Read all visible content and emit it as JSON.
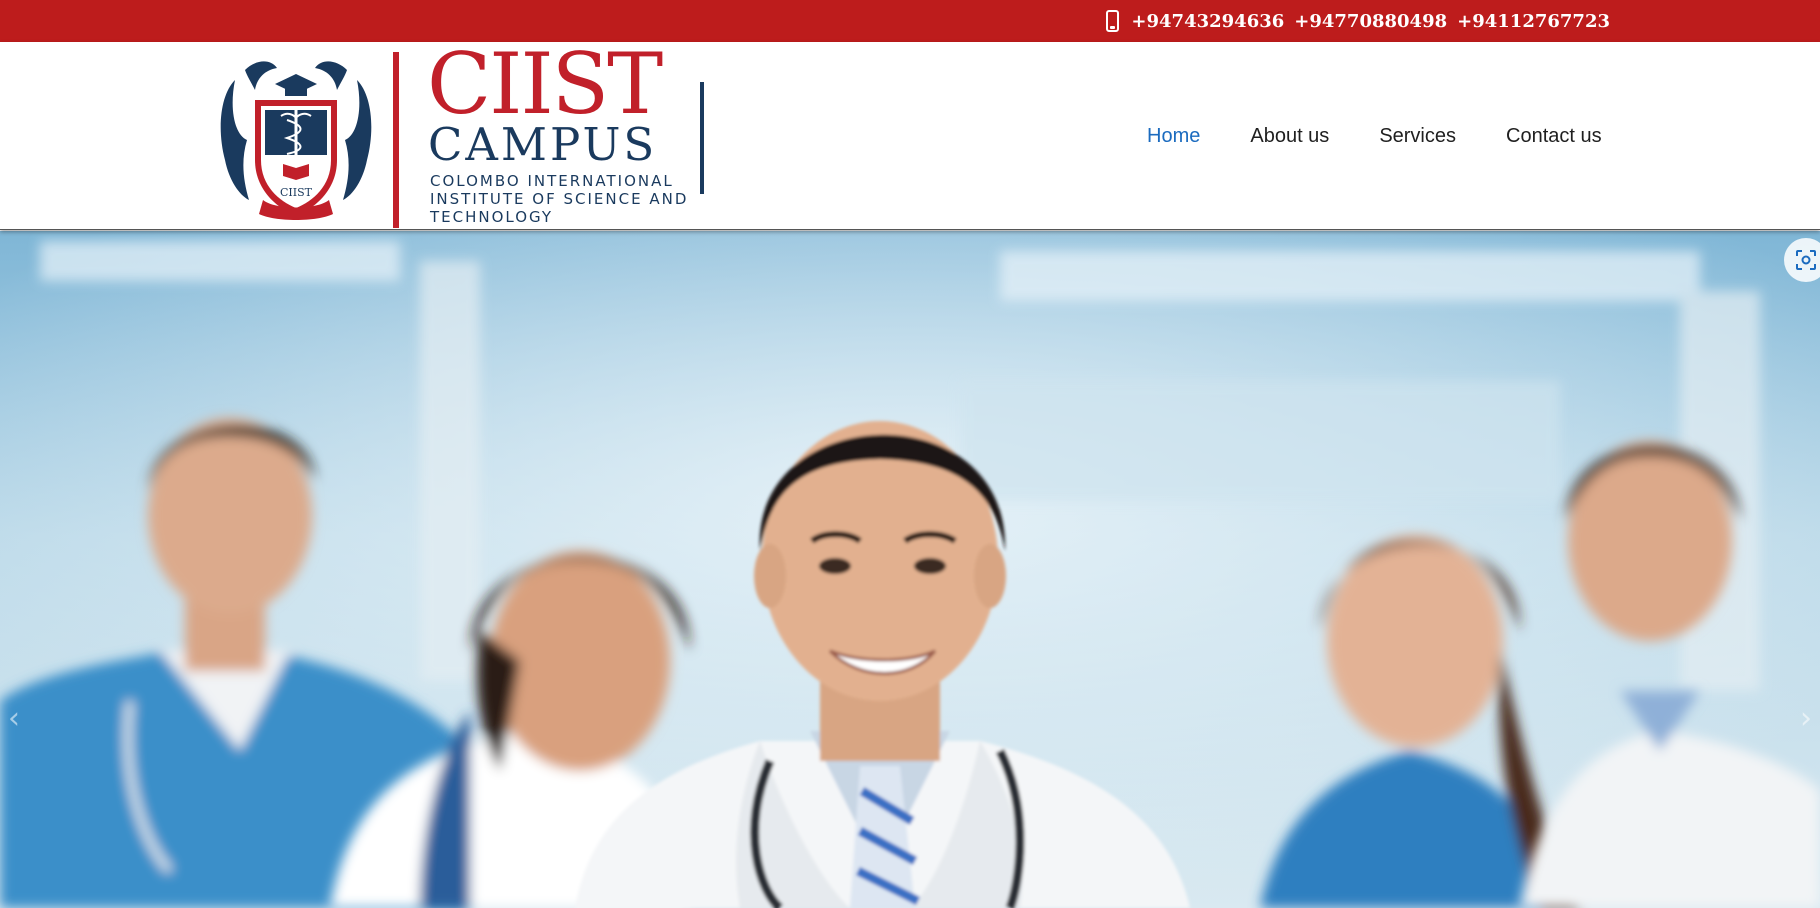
{
  "topbar": {
    "phone_icon": "mobile-phone-icon",
    "phones": [
      "+94743294636",
      "+94770880498",
      "+94112767723"
    ]
  },
  "logo": {
    "title": "CIIST",
    "subtitle": "CAMPUS",
    "tagline": "COLOMBO INTERNATIONAL INSTITUTE OF SCIENCE AND TECHNOLOGY",
    "crest_text": "CIIST"
  },
  "nav": {
    "items": [
      {
        "label": "Home",
        "active": true
      },
      {
        "label": "About us",
        "active": false
      },
      {
        "label": "Services",
        "active": false
      },
      {
        "label": "Contact us",
        "active": false
      }
    ]
  },
  "hero": {
    "image_description": "medical-team-photo",
    "scan_icon": "visual-search-icon",
    "prev_icon": "chevron-left-icon",
    "next_icon": "chevron-right-icon",
    "prev_glyph": "‹",
    "next_glyph": "›"
  },
  "colors": {
    "brand_red": "#bd1c1c",
    "logo_red": "#c1202a",
    "logo_navy": "#1a3a5e",
    "nav_active": "#1b6bbf",
    "nav_text": "#1f1f1f"
  }
}
